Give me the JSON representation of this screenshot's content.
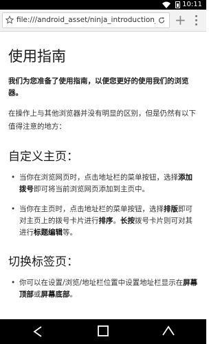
{
  "status_bar": {
    "time": "10:11"
  },
  "browser": {
    "url": "file:///android_asset/ninja_introduction_zh.ht",
    "new_tab_label": "+"
  },
  "content": {
    "title": "使用指南",
    "intro_bold": "我们为您准备了使用指南，以便您更好的使用我们的浏览器。",
    "intro": "在操作上与其他浏览器并没有明显的区别，但是仍然有以下值得注意的地方：",
    "sections": [
      {
        "heading": "自定义主页：",
        "items": [
          {
            "parts": [
              {
                "t": "当你在浏览网页时，点击地址栏的菜单按钮，选择"
              },
              {
                "b": "添加拨号"
              },
              {
                "t": "即可将当前浏览网页添加到主页中。"
              }
            ]
          },
          {
            "parts": [
              {
                "t": "当你在主页时，点击地址栏的菜单按钮，选择"
              },
              {
                "b": "排版"
              },
              {
                "t": "即可对主页上的拨号卡片进行"
              },
              {
                "b": "排序"
              },
              {
                "t": "。"
              },
              {
                "b": "长按"
              },
              {
                "t": "拨号卡片则可对其进行"
              },
              {
                "b": "标题编辑"
              },
              {
                "t": "等。"
              }
            ]
          }
        ]
      },
      {
        "heading": "切换标签页：",
        "items": [
          {
            "parts": [
              {
                "t": "你可以在设置/浏览/地址栏位置中设置地址栏显示在"
              },
              {
                "b": "屏幕顶部"
              },
              {
                "t": "或"
              },
              {
                "b": "屏幕底部"
              },
              {
                "t": "。"
              }
            ]
          }
        ]
      }
    ]
  },
  "icons": {
    "bookmark": "star-outline-icon",
    "reload": "reload-icon",
    "menu": "overflow-menu-icon",
    "back": "back-triangle-icon",
    "home": "home-square-icon",
    "recent": "recents-icon"
  }
}
